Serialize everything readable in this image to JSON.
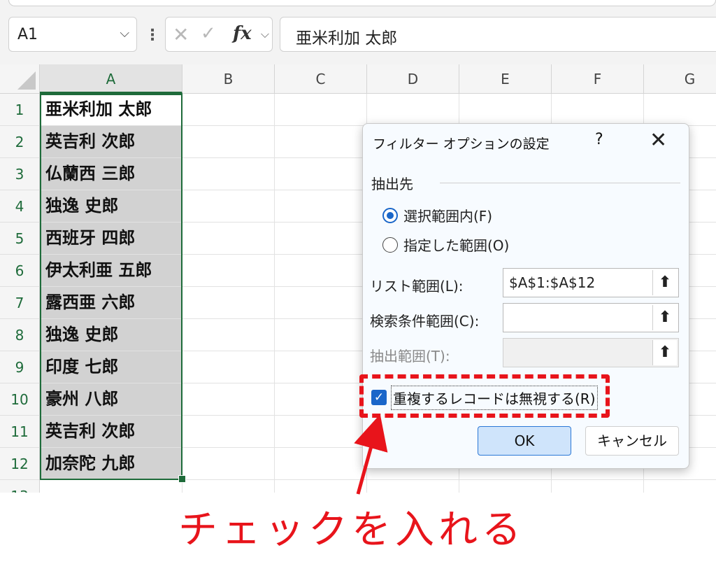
{
  "formula_bar": {
    "name_box": "A1",
    "name_box_chevron": "⌵",
    "more_icon": "⋮",
    "cancel_icon": "✕",
    "enter_icon": "✓",
    "fx_label": "fx",
    "fx_chevron": "⌵",
    "formula_value": "亜米利加 太郎"
  },
  "sheet": {
    "columns": [
      "A",
      "B",
      "C",
      "D",
      "E",
      "F",
      "G"
    ],
    "rows": [
      "1",
      "2",
      "3",
      "4",
      "5",
      "6",
      "7",
      "8",
      "9",
      "10",
      "11",
      "12"
    ],
    "partial_row": "13",
    "column_a": [
      "亜米利加 太郎",
      "英吉利 次郎",
      "仏蘭西 三郎",
      "独逸 史郎",
      "西班牙 四郎",
      "伊太利亜 五郎",
      "露西亜 六郎",
      "独逸 史郎",
      "印度 七郎",
      "豪州 八郎",
      "英吉利 次郎",
      "加奈陀 九郎"
    ],
    "selection_color": "#1e6b3a"
  },
  "dialog": {
    "title": "フィルター オプションの設定",
    "help": "?",
    "close": "✕",
    "section_label": "抽出先",
    "radio_in_place": "選択範囲内(F)",
    "radio_copy": "指定した範囲(O)",
    "list_range_label": "リスト範囲(L):",
    "list_range_value": "$A$1:$A$12",
    "criteria_label": "検索条件範囲(C):",
    "criteria_value": "",
    "copy_to_label": "抽出範囲(T):",
    "copy_to_value": "",
    "collapse_icon": "⬆",
    "unique_label": "重複するレコードは無視する(R)",
    "unique_checked": true,
    "checkmark": "✓",
    "ok": "OK",
    "cancel": "キャンセル"
  },
  "annotation": {
    "text": "チェックを入れる",
    "color": "#e8141b"
  }
}
